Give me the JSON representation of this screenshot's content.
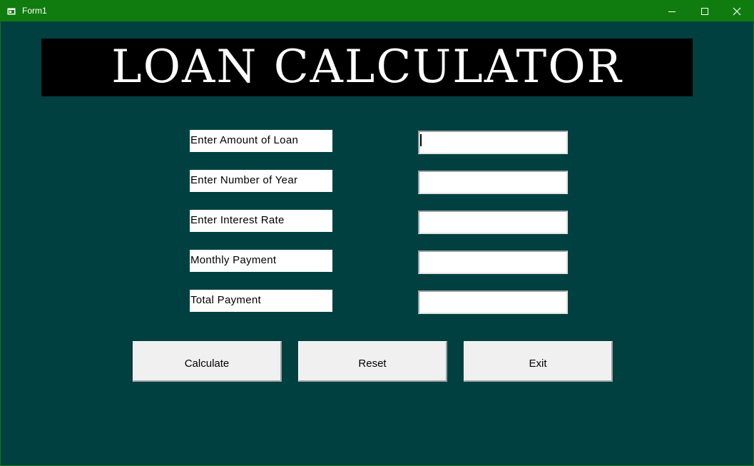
{
  "window": {
    "title": "Form1",
    "icons": {
      "app": "form-app-icon",
      "minimize": "minimize-icon",
      "maximize": "maximize-icon",
      "close": "close-icon"
    }
  },
  "banner": {
    "title": "LOAN CALCULATOR"
  },
  "fields": [
    {
      "label": "Enter Amount of Loan",
      "value": ""
    },
    {
      "label": "Enter Number of Year",
      "value": ""
    },
    {
      "label": "Enter Interest Rate",
      "value": ""
    },
    {
      "label": "Monthly Payment",
      "value": ""
    },
    {
      "label": "Total Payment",
      "value": ""
    }
  ],
  "buttons": {
    "calculate": "Calculate",
    "reset": "Reset",
    "exit": "Exit"
  },
  "colors": {
    "titlebar": "#107c10",
    "form_background": "#004040",
    "banner_background": "#000000",
    "banner_text": "#ffffff"
  }
}
